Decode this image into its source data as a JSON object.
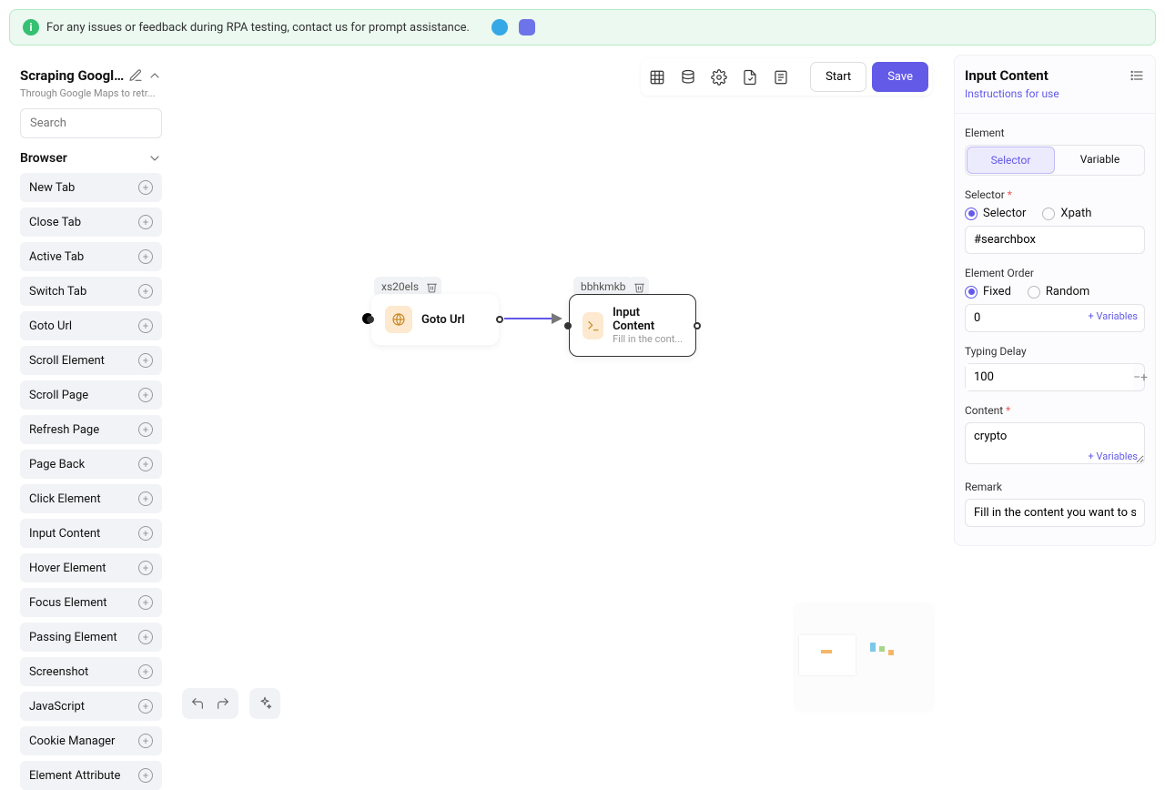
{
  "banner": {
    "text": "For any issues or feedback during RPA testing, contact us for prompt assistance."
  },
  "sidebar": {
    "title": "Scraping Google...",
    "subtitle": "Through Google Maps to retr...",
    "search_placeholder": "Search",
    "category": "Browser",
    "items": [
      "New Tab",
      "Close Tab",
      "Active Tab",
      "Switch Tab",
      "Goto Url",
      "Scroll Element",
      "Scroll Page",
      "Refresh Page",
      "Page Back",
      "Click Element",
      "Input Content",
      "Hover Element",
      "Focus Element",
      "Passing Element",
      "Screenshot",
      "JavaScript",
      "Cookie Manager",
      "Element Attribute"
    ]
  },
  "toolbar": {
    "start": "Start",
    "save": "Save"
  },
  "canvas": {
    "node1": {
      "tag": "xs20els",
      "title": "Goto Url"
    },
    "node2": {
      "tag": "bbhkmkb",
      "title": "Input Content",
      "sub": "Fill in the cont..."
    }
  },
  "inspector": {
    "title": "Input Content",
    "instructions": "Instructions for use",
    "element_label": "Element",
    "segment_selector": "Selector",
    "segment_variable": "Variable",
    "selector_label": "Selector",
    "radio_selector": "Selector",
    "radio_xpath": "Xpath",
    "selector_value": "#searchbox",
    "order_label": "Element Order",
    "radio_fixed": "Fixed",
    "radio_random": "Random",
    "order_value": "0",
    "var_link": "+ Variables",
    "delay_label": "Typing Delay",
    "delay_value": "100",
    "content_label": "Content",
    "content_value": "crypto",
    "remark_label": "Remark",
    "remark_value": "Fill in the content you want to sear"
  }
}
